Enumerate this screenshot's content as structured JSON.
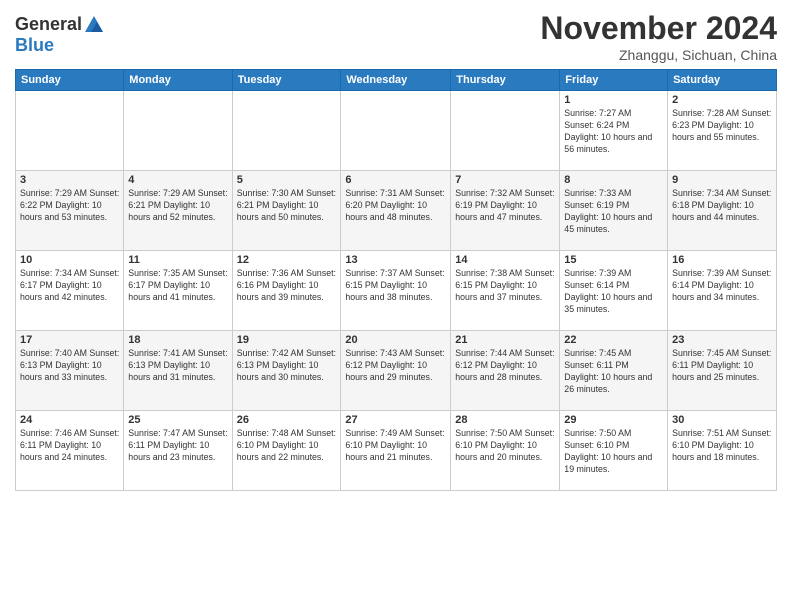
{
  "header": {
    "logo_line1": "General",
    "logo_line2": "Blue",
    "month_title": "November 2024",
    "location": "Zhanggu, Sichuan, China"
  },
  "weekdays": [
    "Sunday",
    "Monday",
    "Tuesday",
    "Wednesday",
    "Thursday",
    "Friday",
    "Saturday"
  ],
  "weeks": [
    [
      {
        "day": "",
        "info": ""
      },
      {
        "day": "",
        "info": ""
      },
      {
        "day": "",
        "info": ""
      },
      {
        "day": "",
        "info": ""
      },
      {
        "day": "",
        "info": ""
      },
      {
        "day": "1",
        "info": "Sunrise: 7:27 AM\nSunset: 6:24 PM\nDaylight: 10 hours and 56 minutes."
      },
      {
        "day": "2",
        "info": "Sunrise: 7:28 AM\nSunset: 6:23 PM\nDaylight: 10 hours and 55 minutes."
      }
    ],
    [
      {
        "day": "3",
        "info": "Sunrise: 7:29 AM\nSunset: 6:22 PM\nDaylight: 10 hours and 53 minutes."
      },
      {
        "day": "4",
        "info": "Sunrise: 7:29 AM\nSunset: 6:21 PM\nDaylight: 10 hours and 52 minutes."
      },
      {
        "day": "5",
        "info": "Sunrise: 7:30 AM\nSunset: 6:21 PM\nDaylight: 10 hours and 50 minutes."
      },
      {
        "day": "6",
        "info": "Sunrise: 7:31 AM\nSunset: 6:20 PM\nDaylight: 10 hours and 48 minutes."
      },
      {
        "day": "7",
        "info": "Sunrise: 7:32 AM\nSunset: 6:19 PM\nDaylight: 10 hours and 47 minutes."
      },
      {
        "day": "8",
        "info": "Sunrise: 7:33 AM\nSunset: 6:19 PM\nDaylight: 10 hours and 45 minutes."
      },
      {
        "day": "9",
        "info": "Sunrise: 7:34 AM\nSunset: 6:18 PM\nDaylight: 10 hours and 44 minutes."
      }
    ],
    [
      {
        "day": "10",
        "info": "Sunrise: 7:34 AM\nSunset: 6:17 PM\nDaylight: 10 hours and 42 minutes."
      },
      {
        "day": "11",
        "info": "Sunrise: 7:35 AM\nSunset: 6:17 PM\nDaylight: 10 hours and 41 minutes."
      },
      {
        "day": "12",
        "info": "Sunrise: 7:36 AM\nSunset: 6:16 PM\nDaylight: 10 hours and 39 minutes."
      },
      {
        "day": "13",
        "info": "Sunrise: 7:37 AM\nSunset: 6:15 PM\nDaylight: 10 hours and 38 minutes."
      },
      {
        "day": "14",
        "info": "Sunrise: 7:38 AM\nSunset: 6:15 PM\nDaylight: 10 hours and 37 minutes."
      },
      {
        "day": "15",
        "info": "Sunrise: 7:39 AM\nSunset: 6:14 PM\nDaylight: 10 hours and 35 minutes."
      },
      {
        "day": "16",
        "info": "Sunrise: 7:39 AM\nSunset: 6:14 PM\nDaylight: 10 hours and 34 minutes."
      }
    ],
    [
      {
        "day": "17",
        "info": "Sunrise: 7:40 AM\nSunset: 6:13 PM\nDaylight: 10 hours and 33 minutes."
      },
      {
        "day": "18",
        "info": "Sunrise: 7:41 AM\nSunset: 6:13 PM\nDaylight: 10 hours and 31 minutes."
      },
      {
        "day": "19",
        "info": "Sunrise: 7:42 AM\nSunset: 6:13 PM\nDaylight: 10 hours and 30 minutes."
      },
      {
        "day": "20",
        "info": "Sunrise: 7:43 AM\nSunset: 6:12 PM\nDaylight: 10 hours and 29 minutes."
      },
      {
        "day": "21",
        "info": "Sunrise: 7:44 AM\nSunset: 6:12 PM\nDaylight: 10 hours and 28 minutes."
      },
      {
        "day": "22",
        "info": "Sunrise: 7:45 AM\nSunset: 6:11 PM\nDaylight: 10 hours and 26 minutes."
      },
      {
        "day": "23",
        "info": "Sunrise: 7:45 AM\nSunset: 6:11 PM\nDaylight: 10 hours and 25 minutes."
      }
    ],
    [
      {
        "day": "24",
        "info": "Sunrise: 7:46 AM\nSunset: 6:11 PM\nDaylight: 10 hours and 24 minutes."
      },
      {
        "day": "25",
        "info": "Sunrise: 7:47 AM\nSunset: 6:11 PM\nDaylight: 10 hours and 23 minutes."
      },
      {
        "day": "26",
        "info": "Sunrise: 7:48 AM\nSunset: 6:10 PM\nDaylight: 10 hours and 22 minutes."
      },
      {
        "day": "27",
        "info": "Sunrise: 7:49 AM\nSunset: 6:10 PM\nDaylight: 10 hours and 21 minutes."
      },
      {
        "day": "28",
        "info": "Sunrise: 7:50 AM\nSunset: 6:10 PM\nDaylight: 10 hours and 20 minutes."
      },
      {
        "day": "29",
        "info": "Sunrise: 7:50 AM\nSunset: 6:10 PM\nDaylight: 10 hours and 19 minutes."
      },
      {
        "day": "30",
        "info": "Sunrise: 7:51 AM\nSunset: 6:10 PM\nDaylight: 10 hours and 18 minutes."
      }
    ]
  ]
}
